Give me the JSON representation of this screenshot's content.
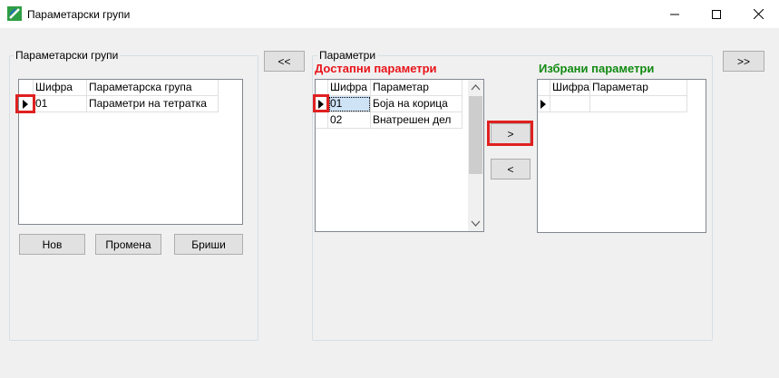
{
  "window": {
    "title": "Параметарски групи",
    "minimize": "—",
    "maximize": "☐",
    "close": "✕"
  },
  "left_group": {
    "label": "Параметарски групи",
    "columns": [
      "Шифра",
      "Параметарска група"
    ],
    "rows": [
      {
        "code": "01",
        "name": "Параметри на тетратка"
      }
    ],
    "buttons": {
      "new": "Нов",
      "edit": "Промена",
      "delete": "Бриши"
    }
  },
  "nav": {
    "back_all": "<<",
    "forward_all": ">>"
  },
  "params_group": {
    "label": "Параметри",
    "available_title": "Достапни параметри",
    "selected_title": "Избрани параметри",
    "available_columns": [
      "Шифра",
      "Параметар"
    ],
    "available_rows": [
      {
        "code": "01",
        "name": "Боја на корица"
      },
      {
        "code": "02",
        "name": "Внатрешен дел"
      }
    ],
    "selected_columns": [
      "Шифра",
      "Параметар"
    ],
    "selected_rows": [],
    "move_right": ">",
    "move_left": "<"
  },
  "colors": {
    "available_title": "#e8141a",
    "selected_title": "#118a11",
    "highlight_box": "#e02020"
  }
}
